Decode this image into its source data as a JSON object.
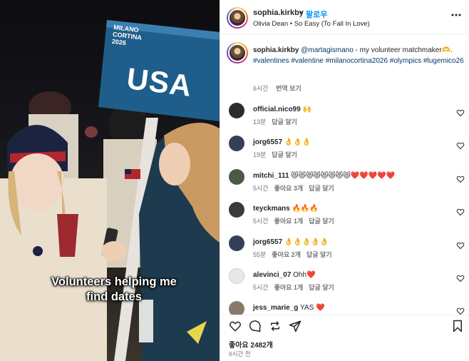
{
  "media": {
    "caption_line1": "Volunteers helping me",
    "caption_line2": "find dates",
    "sign_text": "USA",
    "sign_brand_line1": "MILANO",
    "sign_brand_line2": "CORTINA",
    "sign_brand_line3": "2026"
  },
  "header": {
    "username": "sophia.kirkby",
    "separator": "•",
    "follow_label": "팔로우",
    "audio": "Olivia Dean • So Easy (To Fall In Love)"
  },
  "post_caption": {
    "username": "sophia.kirkby",
    "mention": "@martagismano",
    "text": " - my volunteer matchmaker🫶.",
    "hashtags": "#valentines #valentine #milanocortina2026 #olympics #lugemico26",
    "time": "6시간",
    "translate_label": "번역 보기"
  },
  "comments": [
    {
      "username": "official.nico99",
      "text": "🙌",
      "time": "13분",
      "likes": "",
      "reply": "답글 달기",
      "avatar_color": "#2b2b2b"
    },
    {
      "username": "jorg6557",
      "text": "👌👌👌",
      "time": "19분",
      "likes": "",
      "reply": "답글 달기",
      "avatar_color": "#34405a"
    },
    {
      "username": "mitchi_111",
      "text": "😻😻😻😻😻😻😻😻❤️❤️❤️❤️❤️",
      "time": "5시간",
      "likes": "좋아요 3개",
      "reply": "답글 달기",
      "avatar_color": "#4a5a44"
    },
    {
      "username": "teyckmans",
      "text": "🔥🔥🔥",
      "time": "5시간",
      "likes": "좋아요 1개",
      "reply": "답글 달기",
      "avatar_color": "#3a3a3a"
    },
    {
      "username": "jorg6557",
      "text": "👌👌👌👌👌",
      "time": "55분",
      "likes": "좋아요 2개",
      "reply": "답글 달기",
      "avatar_color": "#34405a"
    },
    {
      "username": "alevinci_07",
      "text": "Ohh❤️",
      "time": "5시간",
      "likes": "좋아요 1개",
      "reply": "답글 달기",
      "avatar_color": "#e8e8e8"
    },
    {
      "username": "jess_marie_g",
      "text": "YAS ❤️",
      "time": "",
      "likes": "",
      "reply": "",
      "avatar_color": "#8a7a6a"
    }
  ],
  "actions": {
    "likes_count": "좋아요 2482개",
    "posted_ago": "6시간 전"
  },
  "colors": {
    "link": "#00376b",
    "follow": "#0095f6",
    "meta": "#737373",
    "sign_blue": "#1f5e8a"
  },
  "icons": [
    "more-icon",
    "heart-icon",
    "comment-icon",
    "share-icon",
    "bookmark-icon"
  ]
}
